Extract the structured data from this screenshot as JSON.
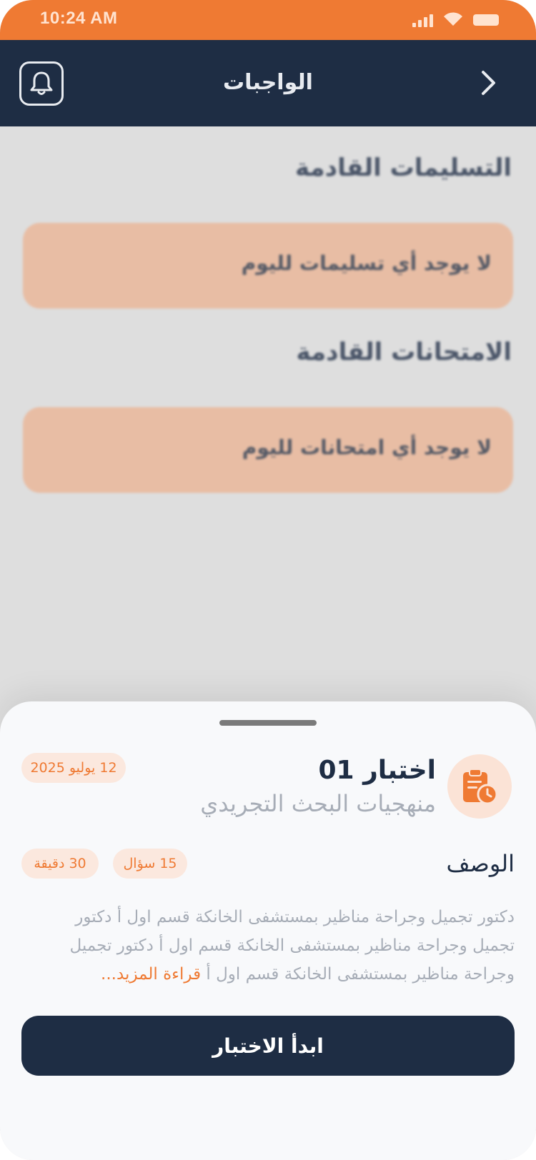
{
  "status_bar": {
    "time": "10:24 AM"
  },
  "app_bar": {
    "title": "الواجبات",
    "bell_icon": "bell-icon",
    "back_icon": "chevron-right-icon"
  },
  "sections": {
    "submissions_title": "التسليمات القادمة",
    "submissions_empty": "لا يوجد أي تسليمات لليوم",
    "exams_title": "الامتحانات القادمة",
    "exams_empty": "لا يوجد أي امتحانات لليوم"
  },
  "sheet": {
    "exam_title": "اختبار 01",
    "subject": "منهجيات البحث التجريدي",
    "date": "12 يوليو 2025",
    "description_label": "الوصف",
    "questions": "15 سؤال",
    "duration": "30 دقيقة",
    "description": "دكتور تجميل وجراحة مناظير بمستشفى الخانكة قسم اول أ دكتور تجميل وجراحة مناظير بمستشفى الخانكة قسم اول أ دكتور تجميل وجراحة مناظير بمستشفى الخانكة قسم اول أ",
    "read_more": "قراءة المزيد...",
    "start_button": "ابدأ الاختبار",
    "exam_icon": "clipboard-clock-icon"
  },
  "colors": {
    "accent": "#ef7a33",
    "navy": "#1e2d44",
    "chip_bg": "#fbe8de",
    "empty_card": "#e8bda4"
  }
}
